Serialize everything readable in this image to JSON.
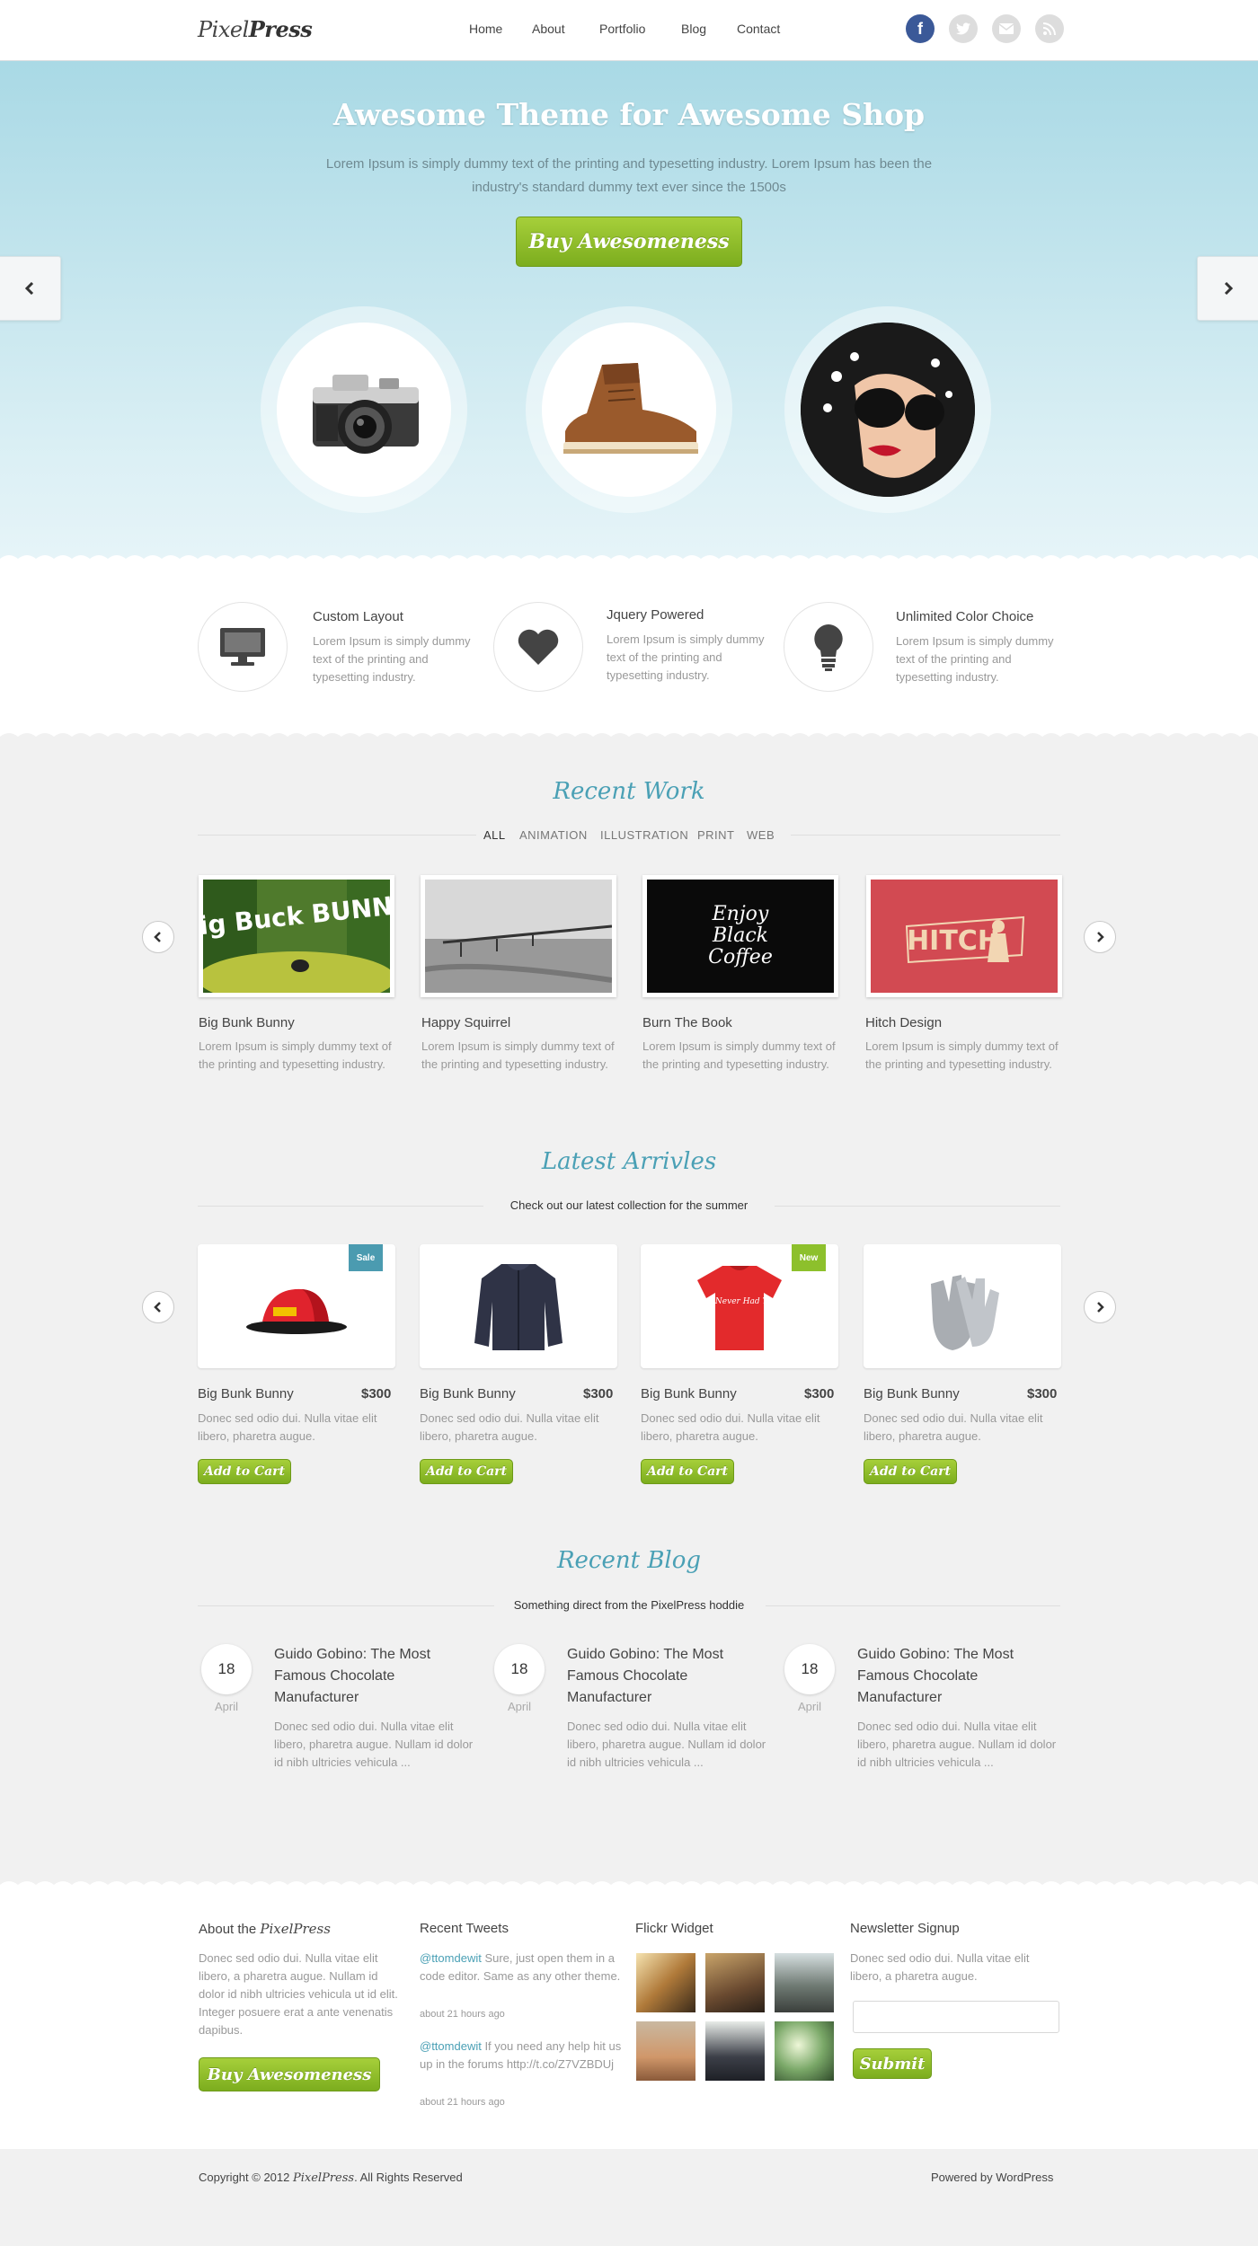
{
  "header": {
    "logo_light": "Pixel",
    "logo_bold": "Press",
    "nav": [
      "Home",
      "About",
      "Portfolio",
      "Blog",
      "Contact"
    ],
    "social_icons": [
      "facebook-icon",
      "twitter-icon",
      "email-icon",
      "rss-icon"
    ],
    "colors": {
      "facebook": "#3b5998",
      "inactive": "#dddddd"
    }
  },
  "hero": {
    "title": "Awesome Theme for Awesome Shop",
    "text": "Lorem Ipsum is simply dummy text of the printing and typesetting industry. Lorem Ipsum has been the industry's standard dummy text ever since the 1500s",
    "button": "Buy Awesomeness",
    "items": [
      "camera",
      "boot",
      "woman-with-sunglasses"
    ]
  },
  "features": [
    {
      "icon": "monitor-icon",
      "title": "Custom Layout",
      "text": "Lorem Ipsum is simply dummy text of the printing and typesetting industry."
    },
    {
      "icon": "heart-icon",
      "title": "Jquery Powered",
      "text": "Lorem Ipsum is simply dummy text of the printing and typesetting industry."
    },
    {
      "icon": "lightbulb-icon",
      "title": "Unlimited Color Choice",
      "text": "Lorem Ipsum is simply dummy text of the printing and typesetting industry."
    }
  ],
  "recent_work": {
    "title": "Recent Work",
    "filters": [
      "ALL",
      "ANIMATION",
      "ILLUSTRATION",
      "PRINT",
      "WEB"
    ],
    "items": [
      {
        "title": "Big Bunk Bunny",
        "text": "Lorem Ipsum is simply  dummy text of the printing and typesetting industry.",
        "thumb_text": "Big Buck BUNNY"
      },
      {
        "title": "Happy Squirrel",
        "text": "Lorem Ipsum is simply  dummy text of the printing and typesetting industry.",
        "thumb_text": ""
      },
      {
        "title": "Burn The Book",
        "text": "Lorem Ipsum is simply  dummy text of the printing and typesetting industry.",
        "thumb_text": "Enjoy Black Coffee"
      },
      {
        "title": "Hitch Design",
        "text": "Lorem Ipsum is simply  dummy text of the printing and typesetting industry.",
        "thumb_text": "HITCH"
      }
    ]
  },
  "latest": {
    "title": "Latest Arrivles",
    "subtitle": "Check out our latest collection for the summer",
    "cart_label": "Add to Cart",
    "items": [
      {
        "title": "Big Bunk Bunny",
        "price": "$300",
        "text": "Donec sed odio dui. Nulla vitae elit libero, pharetra augue.",
        "badge": "Sale",
        "image": "cap"
      },
      {
        "title": "Big Bunk Bunny",
        "price": "$300",
        "text": "Donec sed odio dui. Nulla vitae elit libero, pharetra augue.",
        "badge": "",
        "image": "jacket"
      },
      {
        "title": "Big Bunk Bunny",
        "price": "$300",
        "text": "Donec sed odio dui. Nulla vitae elit libero, pharetra augue.",
        "badge": "New",
        "image": "t-shirt",
        "shirt_text": "Ain't Never Had Them"
      },
      {
        "title": "Big Bunk Bunny",
        "price": "$300",
        "text": "Donec sed odio dui. Nulla vitae elit libero, pharetra augue.",
        "badge": "",
        "image": "gloves"
      }
    ],
    "badge_colors": {
      "Sale": "#4b9bb0",
      "New": "#8dc02c"
    }
  },
  "blog": {
    "title": "Recent Blog",
    "subtitle": "Something direct from the PixelPress hoddie",
    "items": [
      {
        "day": "18",
        "month": "April",
        "title": "Guido Gobino: The Most Famous Chocolate Manufacturer",
        "text": "Donec sed odio dui. Nulla vitae elit libero, pharetra augue. Nullam id dolor id nibh ultricies vehicula ..."
      },
      {
        "day": "18",
        "month": "April",
        "title": "Guido Gobino: The Most Famous Chocolate Manufacturer",
        "text": "Donec sed odio dui. Nulla vitae elit libero, pharetra augue. Nullam id dolor id nibh ultricies vehicula ..."
      },
      {
        "day": "18",
        "month": "April",
        "title": "Guido Gobino: The Most Famous Chocolate Manufacturer",
        "text": "Donec sed odio dui. Nulla vitae elit libero, pharetra augue. Nullam id dolor id nibh ultricies vehicula ..."
      }
    ]
  },
  "footer": {
    "about_title": "About the ",
    "about_brand": "PixelPress",
    "about_text": "Donec sed odio dui. Nulla vitae elit libero, a pharetra augue. Nullam id dolor id nibh ultricies vehicula ut id elit. Integer posuere erat a ante venenatis dapibus.",
    "about_button": "Buy Awesomeness",
    "tweets_title": "Recent Tweets",
    "tweets": [
      {
        "handle": "@ttomdewit",
        "text": " Sure, just open them in a code editor. Same as any other theme.",
        "time": "about 21 hours ago"
      },
      {
        "handle": "@ttomdewit",
        "text": " If you need any help hit us up in the forums http://t.co/Z7VZBDUj",
        "time": "about 21 hours ago"
      }
    ],
    "flickr_title": "Flickr Widget",
    "newsletter_title": "Newsletter Signup",
    "newsletter_text": "Donec sed odio dui. Nulla vitae elit libero, a pharetra augue.",
    "newsletter_value": "",
    "submit": "Submit"
  },
  "bottom": {
    "copyright": "Copyright © 2012 ",
    "copyright_brand": "PixelPress",
    "copyright_end": ". All Rights Reserved",
    "powered": "Powered by WordPress"
  },
  "colors": {
    "accent": "#4aa0b5",
    "green": "#8dc02c",
    "hero_top": "#a9d9e5"
  }
}
